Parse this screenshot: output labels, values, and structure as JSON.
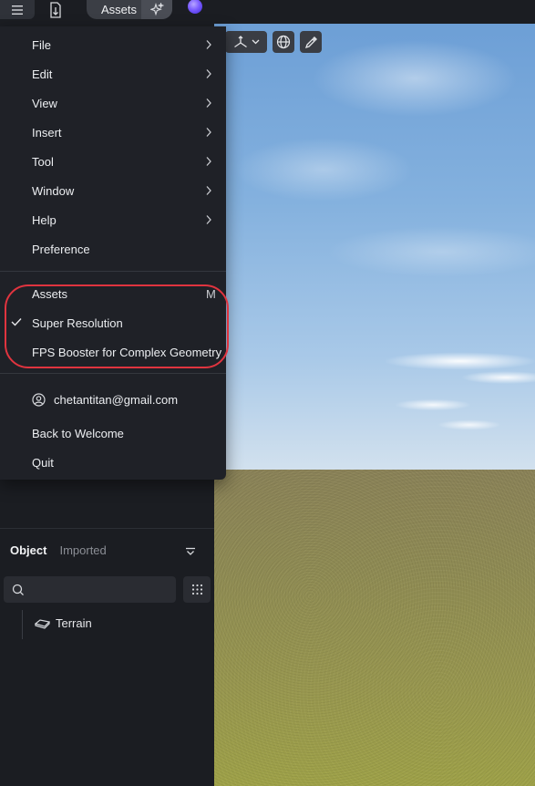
{
  "topbar": {
    "menu_icon": "hamburger-icon",
    "import_icon": "import-file-icon",
    "assets_label": "Assets",
    "sparkle_icon": "sparkle-icon",
    "orb_icon": "ai-orb-icon"
  },
  "viewport_toolbar": {
    "transform_icon": "axis-gizmo-icon",
    "dropdown_icon": "chevron-down-icon",
    "globe_icon": "globe-icon",
    "picker_icon": "eyedropper-icon"
  },
  "menu": {
    "items": [
      {
        "label": "File",
        "has_submenu": true
      },
      {
        "label": "Edit",
        "has_submenu": true
      },
      {
        "label": "View",
        "has_submenu": true
      },
      {
        "label": "Insert",
        "has_submenu": true
      },
      {
        "label": "Tool",
        "has_submenu": true
      },
      {
        "label": "Window",
        "has_submenu": true
      },
      {
        "label": "Help",
        "has_submenu": true
      },
      {
        "label": "Preference",
        "has_submenu": false
      }
    ],
    "toggles": [
      {
        "label": "Assets",
        "shortcut": "M",
        "checked": false
      },
      {
        "label": "Super Resolution",
        "checked": true
      },
      {
        "label": "FPS Booster for Complex Geometry",
        "checked": false
      }
    ],
    "account": {
      "email": "chetantitan@gmail.com",
      "icon": "user-circle-icon"
    },
    "bottom_items": [
      {
        "label": "Back to Welcome"
      },
      {
        "label": "Quit"
      }
    ],
    "highlight_color": "#e0343f"
  },
  "left_panel": {
    "tabs": [
      {
        "label": "Object",
        "active": true
      },
      {
        "label": "Imported",
        "active": false
      }
    ],
    "filter_icon": "filter-dropdown-icon",
    "search": {
      "placeholder": "",
      "value": "",
      "icon": "search-icon"
    },
    "grid_icon": "grid-dots-icon",
    "tree": [
      {
        "label": "Terrain",
        "icon": "terrain-layer-icon"
      }
    ]
  }
}
